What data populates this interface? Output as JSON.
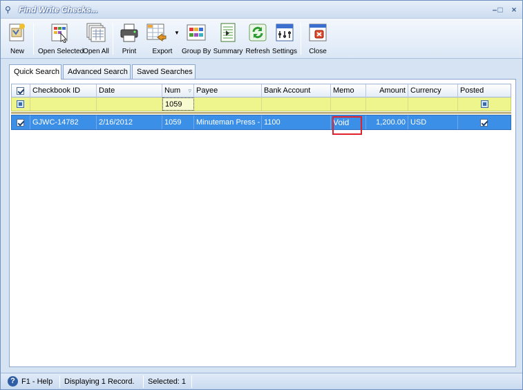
{
  "window": {
    "title": "Find Write Checks...",
    "minimize": "–",
    "maximize": "□",
    "close": "×"
  },
  "toolbar": {
    "new": "New",
    "open_selected": "Open Selected",
    "open_all": "Open All",
    "print": "Print",
    "export": "Export",
    "group_by": "Group By",
    "summary": "Summary",
    "refresh": "Refresh",
    "settings": "Settings",
    "close": "Close"
  },
  "tabs": [
    "Quick Search",
    "Advanced Search",
    "Saved Searches"
  ],
  "grid": {
    "columns": [
      "Checkbook ID",
      "Date",
      "Num",
      "Payee",
      "Bank Account",
      "Memo",
      "Amount",
      "Currency",
      "Posted"
    ],
    "filter": {
      "num": "1059"
    },
    "rows": [
      {
        "checkbook_id": "GJWC-14782",
        "date": "2/16/2012",
        "num": "1059",
        "payee": "Minuteman Press - I",
        "bank_account": "1100",
        "memo": "Void",
        "amount": "1,200.00",
        "currency": "USD",
        "posted": true
      }
    ]
  },
  "status": {
    "help": "F1 - Help",
    "displaying": "Displaying 1 Record.",
    "selected": "Selected: 1"
  },
  "colors": {
    "selection": "#3c8fe6",
    "filter_row": "#eef58d",
    "highlight_box": "#e0202b"
  }
}
